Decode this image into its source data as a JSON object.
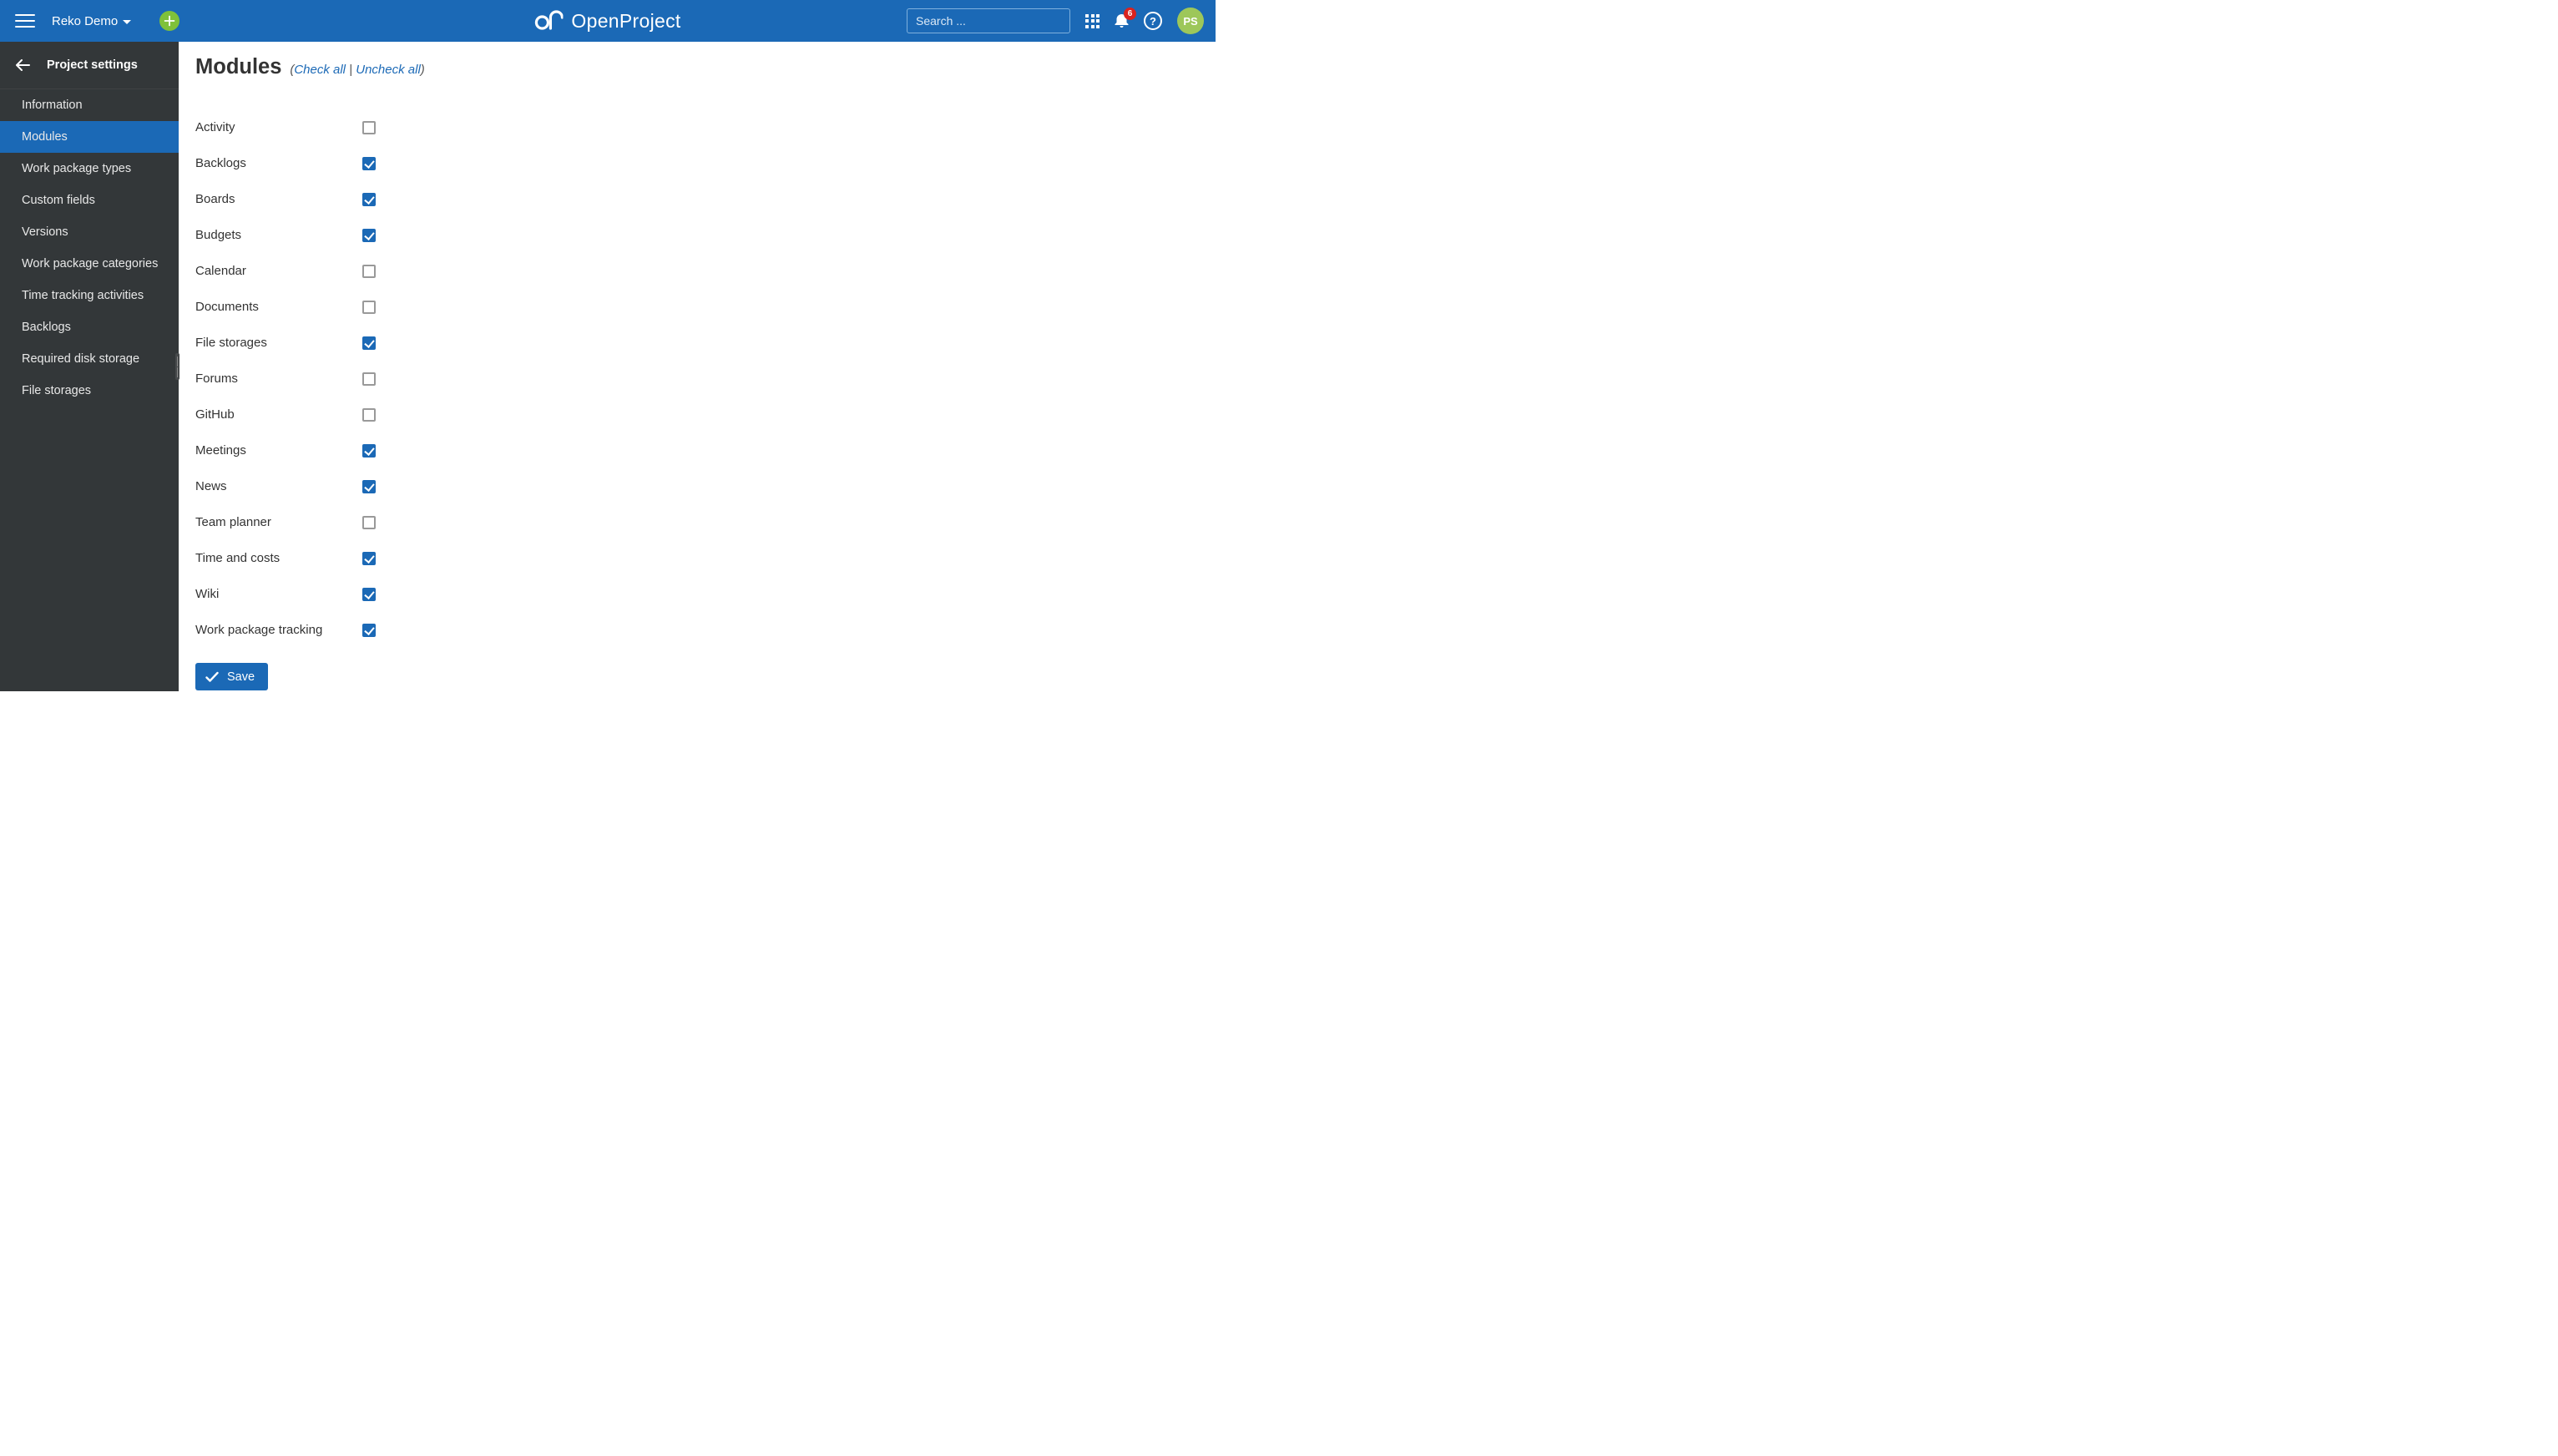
{
  "header": {
    "project_name": "Reko Demo",
    "logo_text": "OpenProject",
    "search_placeholder": "Search ...",
    "notification_count": "6",
    "avatar_initials": "PS"
  },
  "sidebar": {
    "title": "Project settings",
    "items": [
      {
        "label": "Information",
        "active": false
      },
      {
        "label": "Modules",
        "active": true
      },
      {
        "label": "Work package types",
        "active": false
      },
      {
        "label": "Custom fields",
        "active": false
      },
      {
        "label": "Versions",
        "active": false
      },
      {
        "label": "Work package categories",
        "active": false
      },
      {
        "label": "Time tracking activities",
        "active": false
      },
      {
        "label": "Backlogs",
        "active": false
      },
      {
        "label": "Required disk storage",
        "active": false
      },
      {
        "label": "File storages",
        "active": false
      }
    ]
  },
  "page": {
    "title": "Modules",
    "paren_open": "(",
    "check_all": "Check all",
    "separator": " | ",
    "uncheck_all": "Uncheck all",
    "paren_close": ")"
  },
  "modules": [
    {
      "label": "Activity",
      "checked": false
    },
    {
      "label": "Backlogs",
      "checked": true
    },
    {
      "label": "Boards",
      "checked": true
    },
    {
      "label": "Budgets",
      "checked": true
    },
    {
      "label": "Calendar",
      "checked": false
    },
    {
      "label": "Documents",
      "checked": false
    },
    {
      "label": "File storages",
      "checked": true
    },
    {
      "label": "Forums",
      "checked": false
    },
    {
      "label": "GitHub",
      "checked": false
    },
    {
      "label": "Meetings",
      "checked": true
    },
    {
      "label": "News",
      "checked": true
    },
    {
      "label": "Team planner",
      "checked": false
    },
    {
      "label": "Time and costs",
      "checked": true
    },
    {
      "label": "Wiki",
      "checked": true
    },
    {
      "label": "Work package tracking",
      "checked": true
    }
  ],
  "buttons": {
    "save": "Save"
  }
}
